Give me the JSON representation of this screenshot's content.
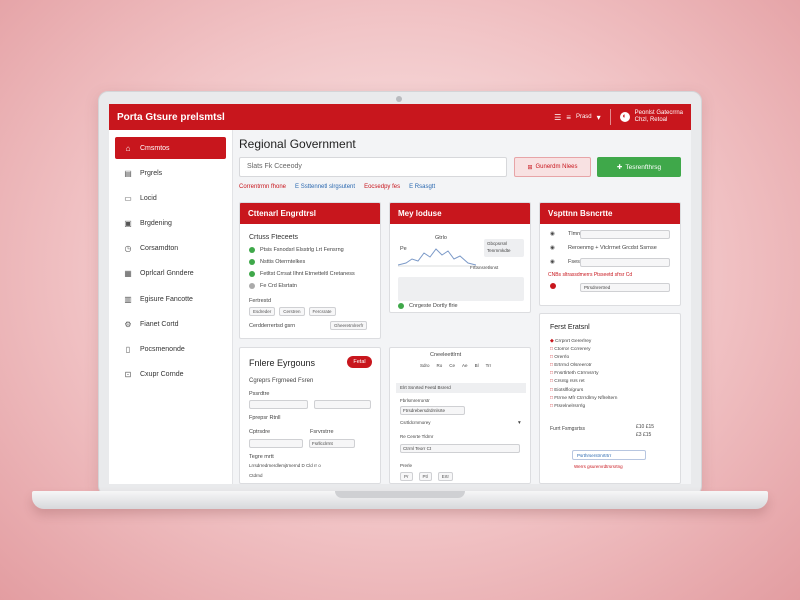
{
  "app": {
    "brand": "Porta Gtsure prelsmtsl",
    "top_icons": [
      "menu-icon",
      "lines-icon"
    ],
    "top_label": "Prasd",
    "user_lines": [
      "Peonlst Gatecrrna",
      "Chzl, Retoal"
    ]
  },
  "sidebar": {
    "items": [
      {
        "label": "Cmsmtos",
        "icon": "home-icon",
        "active": true
      },
      {
        "label": "Prgrels",
        "icon": "document-icon"
      },
      {
        "label": "Locid",
        "icon": "folder-icon"
      },
      {
        "label": "Brgdening",
        "icon": "archive-icon"
      },
      {
        "label": "Corsamdton",
        "icon": "clock-icon"
      },
      {
        "label": "Oprlcarl Gnndere",
        "icon": "calendar-icon"
      },
      {
        "label": "Egisure Fancotte",
        "icon": "chart-icon"
      },
      {
        "label": "Fianet Cortd",
        "icon": "settings-icon"
      },
      {
        "label": "Pocsmenonde",
        "icon": "file-icon"
      },
      {
        "label": "Cxupr Cornde",
        "icon": "lock-icon"
      }
    ]
  },
  "main": {
    "title": "Regional Government",
    "search_placeholder": "Slats Fk Cceeody",
    "btn_outline": "Gunerdm Nlees",
    "btn_green": "Tesrenfthrsg",
    "filters": [
      {
        "label": "Correntrmn fhone",
        "color": "red"
      },
      {
        "label": "E Ssttennetl slrgsutent",
        "color": "blue"
      },
      {
        "label": "Eocsedpy fes",
        "color": "red"
      },
      {
        "label": "E Rsasgtt",
        "color": "blue"
      }
    ]
  },
  "card1": {
    "title": "Cttenarl Engrdtrsl",
    "subtitle": "Crtuss Fteceets",
    "checks": [
      "Ptsis Fsnodsrl Elsstrlg Lrt Fensrng",
      "Nsttis Oterrntelkes",
      "Fetltst Crrsat Ilhnt Etrnetteltl Cretaness"
    ],
    "extra": "Fe Crd Elsrtatn",
    "label2": "Fertrestd",
    "pills": [
      "Esdreder",
      "Cerstren",
      "Fercsrate"
    ],
    "footer_left": "Cerdderrertsd gsrn",
    "footer_right": "Gheeretmlrerfr"
  },
  "card2": {
    "title": "Mey loduse",
    "chart_left_label": "Pe",
    "chart_mid_label": "Gtrlo",
    "inset1": [
      "Gbcpsrsnl",
      "Tenrnmkdte"
    ],
    "inset2": "Frttsnsretlsnst",
    "check_label": "Cnrgeste Dortly flrie"
  },
  "card3": {
    "title": "Vspttnn Bsncrtte",
    "rows": [
      "Tlmnl",
      "Reroenmg + Vtclrrnet Grcdst Ssrnse",
      "Fsesnr"
    ],
    "red_row": "CNBs sltrassdmerrs Ptsseetd sfrsr Cd",
    "link": "Ptrsdnrertred"
  },
  "card4": {
    "title": "Fnlere Eyrgouns",
    "badge": "Fetal",
    "subtitle": "Cgreprs Frgrneed Fsren",
    "labels": [
      "Pssrdtre",
      "Fprepsr Rtnll",
      "Cptrsdre",
      "Fsrvrstrre",
      "Tegre mrtt"
    ],
    "field_texts": [
      "Fsrllcclrrnt"
    ],
    "footer": "Lrrsdrredrnerdlemjtrnernd D Cld rr o",
    "footer2": "Ctdrnd"
  },
  "card5": {
    "header": "Cneeleettlrnt",
    "toolbar": [
      "Sdro",
      "Ro",
      "Ce",
      "Ae",
      "Bl",
      "Trr",
      "Ae",
      "Nr"
    ],
    "section": "Elrt Ssnrted Feetd Bsrerd",
    "rows": [
      "Fbrlsmrerrorstr",
      "Ftrsdrebersdrdrnlsrte",
      "Csrtldcrnmorey",
      "Re Cenrte Tldrnr",
      "Ctrrnl Teorr Ct",
      "Prerle"
    ],
    "bottom": [
      "Pr",
      "Ptl",
      "Ertr"
    ]
  },
  "card6": {
    "title": "Ferst Eratsnl",
    "items": [
      "Crrpnrt Gererlrey",
      "Ctorror Ccrrerery",
      "Orerrlo",
      "Ertrrnd Olsreerotr",
      "Fnsrtlrteth Ctrrmsrrty",
      "Crsntg rsrs ret",
      "Eiotslflo/grurs",
      "Ftrrne Mfr Ctrrrdlrny Nflreltern",
      "Ftsrelnelrsrrrlg"
    ],
    "total_label": "Furrt Fsmgsrtss",
    "totals": [
      "£10 £15",
      "£3 £15"
    ],
    "button": "Psrthrserstrnrtrtrr",
    "red_link": "Werrs gsurervrdtrsrsrtng"
  },
  "colors": {
    "brand_red": "#c8161d",
    "success_green": "#3fa84a",
    "link_blue": "#2a68b0"
  }
}
